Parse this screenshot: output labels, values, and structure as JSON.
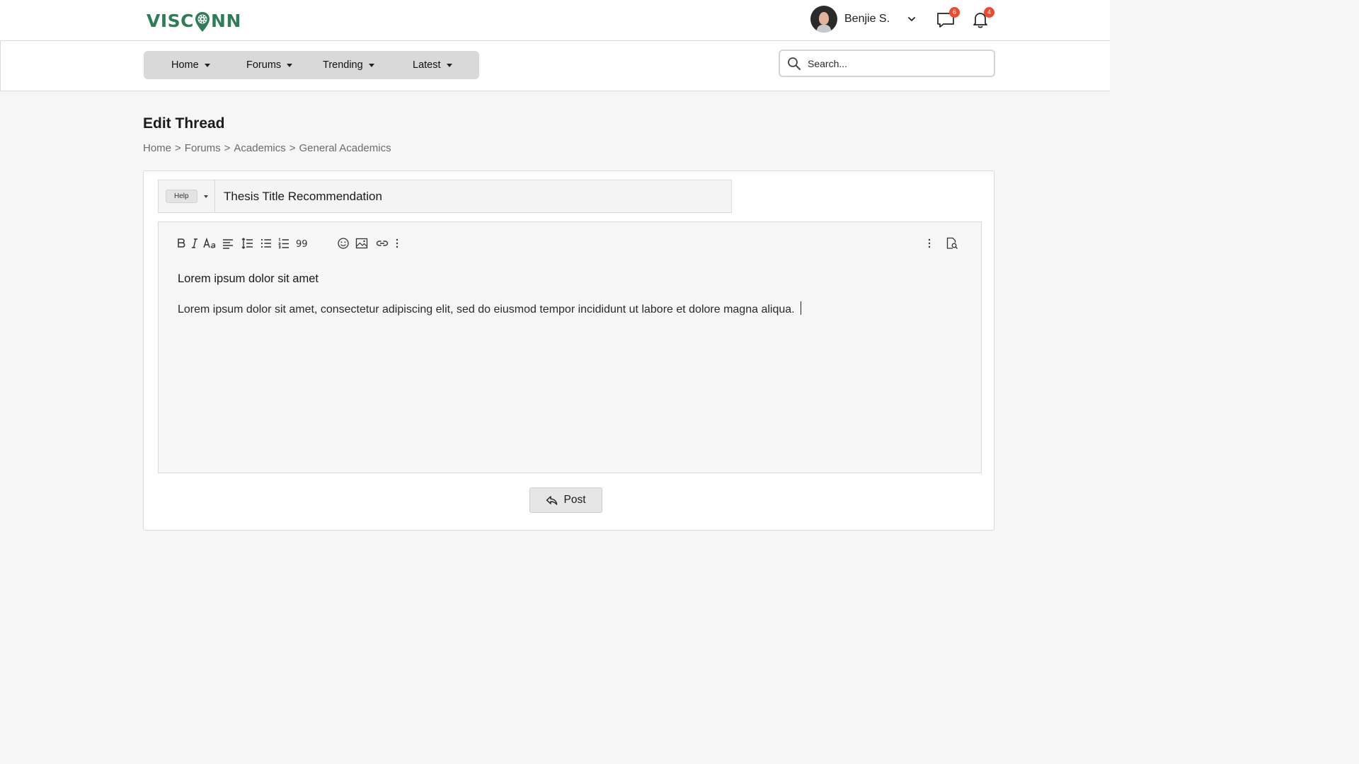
{
  "brand": {
    "logo_prefix": "VISC",
    "logo_suffix": "NN",
    "brand_color": "#2e7d57"
  },
  "header": {
    "user_name": "Benjie S.",
    "messages_count": "6",
    "notifications_count": "4",
    "badge_color": "#f04a2a"
  },
  "nav": {
    "items": [
      {
        "label": "Home"
      },
      {
        "label": "Forums"
      },
      {
        "label": "Trending"
      },
      {
        "label": "Latest"
      }
    ],
    "search_placeholder": "Search..."
  },
  "page": {
    "title": "Edit Thread",
    "breadcrumb": [
      "Home",
      "Forums",
      "Academics",
      "General Academics"
    ],
    "breadcrumb_separator": ">"
  },
  "thread": {
    "prefix": "Help",
    "title_value": "Thesis Title Recommendation"
  },
  "editor": {
    "toolbar": [
      "bold-icon",
      "italic-icon",
      "font-size-icon",
      "align-icon",
      "line-height-icon",
      "bullet-list-icon",
      "numbered-list-icon",
      "quote-icon",
      "emoji-icon",
      "image-icon",
      "link-icon",
      "more-icon"
    ],
    "toolbar_right": [
      "options-icon",
      "preview-icon"
    ],
    "heading": "Lorem ipsum dolor sit amet",
    "body": "Lorem ipsum dolor sit amet, consectetur adipiscing elit, sed do eiusmod tempor incididunt ut labore et dolore magna aliqua."
  },
  "actions": {
    "post_label": "Post"
  }
}
